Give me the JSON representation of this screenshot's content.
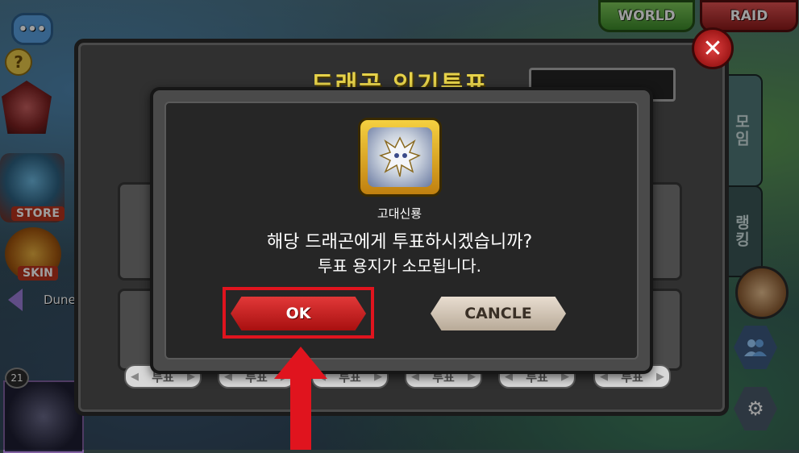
{
  "top_buttons": {
    "world": "WORLD",
    "raid": "RAID"
  },
  "left_menu": {
    "store": "STORE",
    "skin": "SKIN",
    "dungeon_partial": "Dune",
    "level": "21"
  },
  "right_tabs": {
    "collection": "모임",
    "ranking": "랭킹"
  },
  "back_panel": {
    "title": "드래곤 인기투표",
    "vote_label": "투표",
    "vote_buttons": [
      "투표",
      "투표",
      "투표",
      "투표",
      "투표",
      "투표"
    ]
  },
  "dialog": {
    "dragon_name": "고대신룡",
    "question": "해당 드래곤에게 투표하시겠습니까?",
    "note": "투표 용지가 소모됩니다.",
    "ok_label": "OK",
    "cancel_label": "CANCLE"
  },
  "colors": {
    "ok": "#d42424",
    "cancel": "#d6cbbd",
    "highlight": "#e0141e",
    "title": "#e6d24a"
  },
  "icons": {
    "chat": "chat-bubble-icon",
    "help": "question-icon",
    "close": "close-x-icon",
    "people": "people-icon",
    "settings": "gear-icon",
    "arrow": "red-up-arrow-icon"
  }
}
